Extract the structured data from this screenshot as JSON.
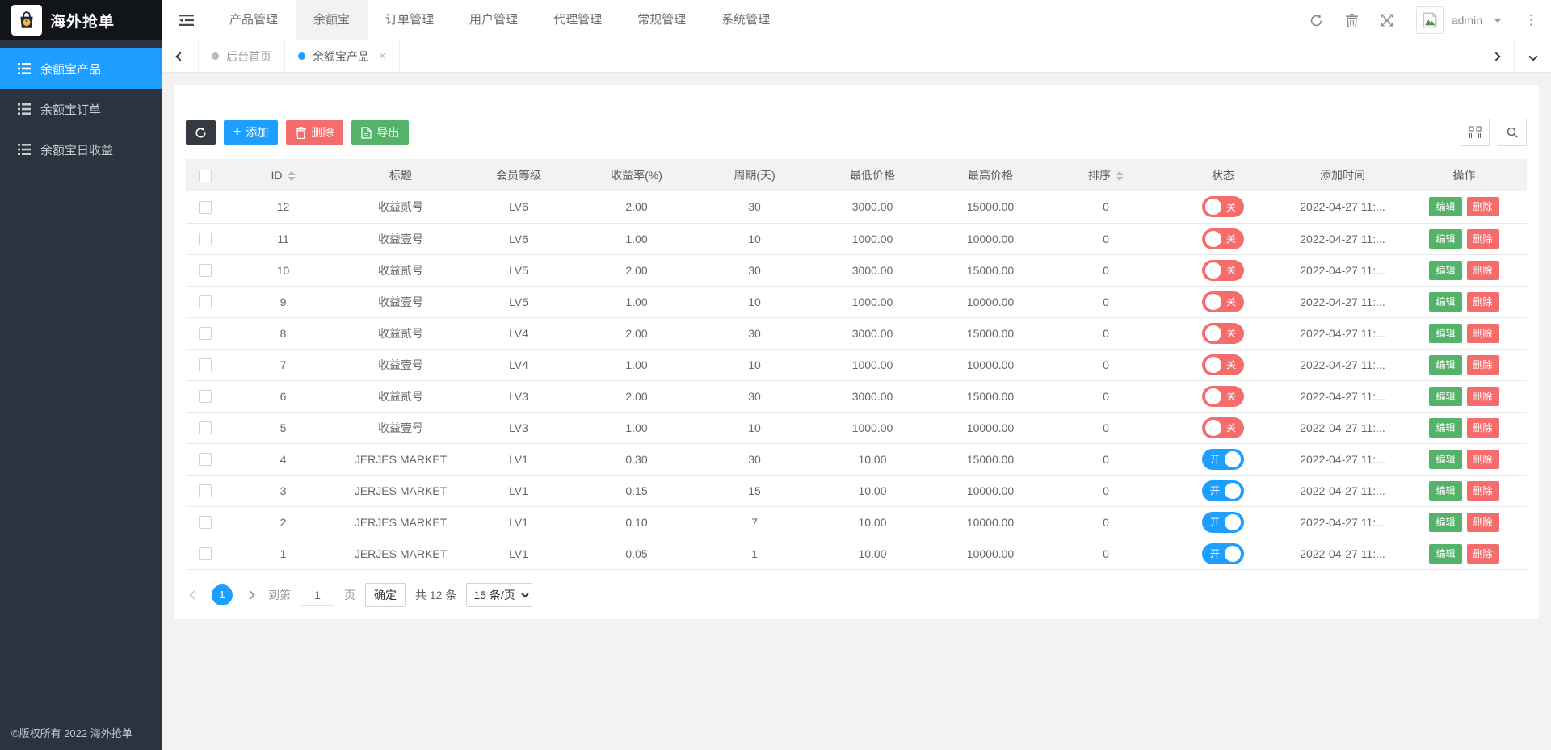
{
  "brand": {
    "title": "海外抢单"
  },
  "header": {
    "nav_items": [
      {
        "label": "产品管理",
        "active": false
      },
      {
        "label": "余额宝",
        "active": true
      },
      {
        "label": "订单管理",
        "active": false
      },
      {
        "label": "用户管理",
        "active": false
      },
      {
        "label": "代理管理",
        "active": false
      },
      {
        "label": "常规管理",
        "active": false
      },
      {
        "label": "系统管理",
        "active": false
      }
    ],
    "username": "admin"
  },
  "sidebar": {
    "items": [
      {
        "label": "余额宝产品",
        "active": true
      },
      {
        "label": "余额宝订单",
        "active": false
      },
      {
        "label": "余额宝日收益",
        "active": false
      }
    ],
    "copyright": "©版权所有 2022 海外抢单"
  },
  "tabbar": {
    "tabs": [
      {
        "label": "后台首页",
        "active": false,
        "closable": false
      },
      {
        "label": "余额宝产品",
        "active": true,
        "closable": true
      }
    ]
  },
  "toolbar": {
    "add_label": "添加",
    "delete_label": "删除",
    "export_label": "导出"
  },
  "table": {
    "columns": [
      "ID",
      "标题",
      "会员等级",
      "收益率(%)",
      "周期(天)",
      "最低价格",
      "最高价格",
      "排序",
      "状态",
      "添加时间",
      "操作"
    ],
    "sortable_columns": [
      "ID",
      "排序"
    ],
    "switch_on_label": "开",
    "switch_off_label": "关",
    "edit_label": "编辑",
    "delete_label": "删除",
    "rows": [
      {
        "id": "12",
        "title": "收益贰号",
        "level": "LV6",
        "rate": "2.00",
        "cycle": "30",
        "min_price": "3000.00",
        "max_price": "15000.00",
        "sort": "0",
        "status": "off",
        "time": "2022-04-27 11:..."
      },
      {
        "id": "11",
        "title": "收益壹号",
        "level": "LV6",
        "rate": "1.00",
        "cycle": "10",
        "min_price": "1000.00",
        "max_price": "10000.00",
        "sort": "0",
        "status": "off",
        "time": "2022-04-27 11:..."
      },
      {
        "id": "10",
        "title": "收益贰号",
        "level": "LV5",
        "rate": "2.00",
        "cycle": "30",
        "min_price": "3000.00",
        "max_price": "15000.00",
        "sort": "0",
        "status": "off",
        "time": "2022-04-27 11:..."
      },
      {
        "id": "9",
        "title": "收益壹号",
        "level": "LV5",
        "rate": "1.00",
        "cycle": "10",
        "min_price": "1000.00",
        "max_price": "10000.00",
        "sort": "0",
        "status": "off",
        "time": "2022-04-27 11:..."
      },
      {
        "id": "8",
        "title": "收益贰号",
        "level": "LV4",
        "rate": "2.00",
        "cycle": "30",
        "min_price": "3000.00",
        "max_price": "15000.00",
        "sort": "0",
        "status": "off",
        "time": "2022-04-27 11:..."
      },
      {
        "id": "7",
        "title": "收益壹号",
        "level": "LV4",
        "rate": "1.00",
        "cycle": "10",
        "min_price": "1000.00",
        "max_price": "10000.00",
        "sort": "0",
        "status": "off",
        "time": "2022-04-27 11:..."
      },
      {
        "id": "6",
        "title": "收益贰号",
        "level": "LV3",
        "rate": "2.00",
        "cycle": "30",
        "min_price": "3000.00",
        "max_price": "15000.00",
        "sort": "0",
        "status": "off",
        "time": "2022-04-27 11:..."
      },
      {
        "id": "5",
        "title": "收益壹号",
        "level": "LV3",
        "rate": "1.00",
        "cycle": "10",
        "min_price": "1000.00",
        "max_price": "10000.00",
        "sort": "0",
        "status": "off",
        "time": "2022-04-27 11:..."
      },
      {
        "id": "4",
        "title": "JERJES MARKET",
        "level": "LV1",
        "rate": "0.30",
        "cycle": "30",
        "min_price": "10.00",
        "max_price": "15000.00",
        "sort": "0",
        "status": "on",
        "time": "2022-04-27 11:..."
      },
      {
        "id": "3",
        "title": "JERJES MARKET",
        "level": "LV1",
        "rate": "0.15",
        "cycle": "15",
        "min_price": "10.00",
        "max_price": "10000.00",
        "sort": "0",
        "status": "on",
        "time": "2022-04-27 11:..."
      },
      {
        "id": "2",
        "title": "JERJES MARKET",
        "level": "LV1",
        "rate": "0.10",
        "cycle": "7",
        "min_price": "10.00",
        "max_price": "10000.00",
        "sort": "0",
        "status": "on",
        "time": "2022-04-27 11:..."
      },
      {
        "id": "1",
        "title": "JERJES MARKET",
        "level": "LV1",
        "rate": "0.05",
        "cycle": "1",
        "min_price": "10.00",
        "max_price": "10000.00",
        "sort": "0",
        "status": "on",
        "time": "2022-04-27 11:..."
      }
    ]
  },
  "pagination": {
    "current_page": "1",
    "goto_label": "到第",
    "goto_value": "1",
    "page_unit": "页",
    "confirm_label": "确定",
    "total_label": "共 12 条",
    "page_size_label": "15 条/页"
  },
  "colors": {
    "primary": "#1e9fff",
    "danger": "#f56c6c",
    "success": "#55b269",
    "dark": "#343a40"
  }
}
